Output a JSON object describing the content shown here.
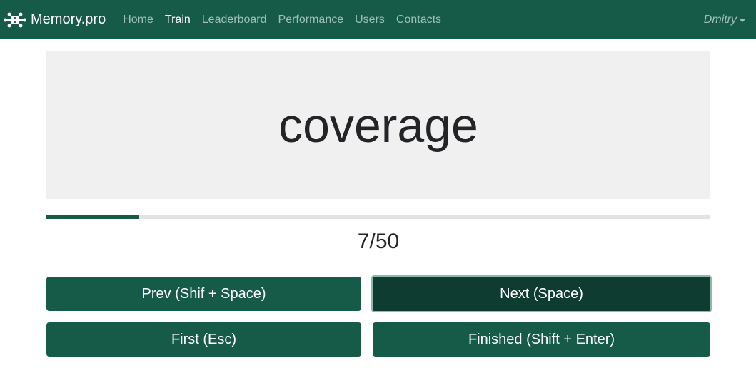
{
  "navbar": {
    "brand": "Memory.pro",
    "links": [
      "Home",
      "Train",
      "Leaderboard",
      "Performance",
      "Users",
      "Contacts"
    ],
    "active": "Train",
    "user": "Dmitry"
  },
  "card": {
    "word": "coverage"
  },
  "progress": {
    "current": 7,
    "total": 50,
    "label": "7/50",
    "fraction": 0.14
  },
  "buttons": {
    "prev": "Prev (Shif + Space)",
    "next": "Next (Space)",
    "first": "First (Esc)",
    "finished": "Finished (Shift + Enter)"
  },
  "colors": {
    "primary": "#165a48",
    "focused": "#0f3c30",
    "card": "#f0f0f0"
  },
  "icons": {
    "brand": "network-nodes-icon",
    "user_menu": "caret-down-icon"
  }
}
